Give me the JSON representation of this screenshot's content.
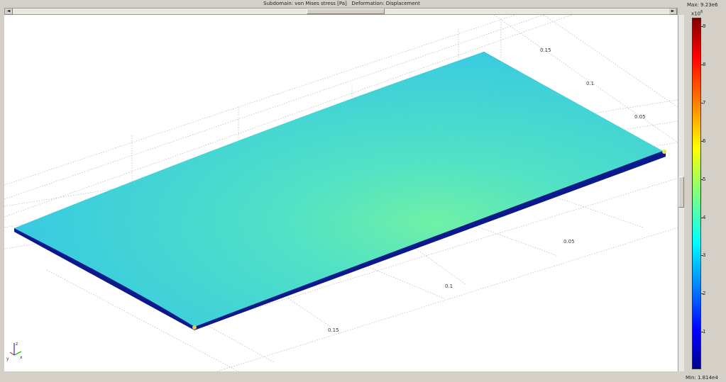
{
  "window": {
    "title": "Subdomain: von Mises stress [Pa]   Deformation: Displacement"
  },
  "axes": {
    "x_ticks": [
      "0.15",
      "0.1",
      "0.05"
    ],
    "y_ticks": [
      "0.15",
      "0.1",
      "0.05"
    ],
    "axis_names": {
      "x": "x",
      "y": "y",
      "z": "z"
    }
  },
  "colorbar": {
    "max_label": "Max: 9.23e6",
    "min_label": "Min: 1.814e4",
    "exponent_base": "x10",
    "exponent_power": "6",
    "ticks": [
      "9",
      "8",
      "7",
      "6",
      "5",
      "4",
      "3",
      "2",
      "1"
    ],
    "colormap": "jet",
    "range": [
      18140,
      9230000
    ]
  },
  "scrollbars": {
    "left_arrow": "◄",
    "right_arrow": "►"
  },
  "colors": {
    "plate_main": "#33c6e0",
    "plate_highlight": "#6ff0a0",
    "edge": "#0a1a8c",
    "background": "#d4d0c8"
  }
}
